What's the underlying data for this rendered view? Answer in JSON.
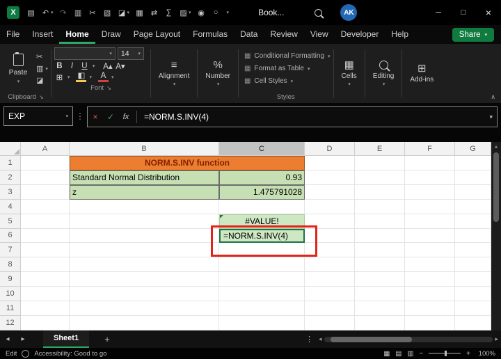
{
  "titlebar": {
    "title": "Book...",
    "avatar_initials": "AK"
  },
  "menubar": {
    "items": [
      "File",
      "Insert",
      "Home",
      "Draw",
      "Page Layout",
      "Formulas",
      "Data",
      "Review",
      "View",
      "Developer",
      "Help"
    ],
    "active": "Home",
    "share_label": "Share"
  },
  "ribbon": {
    "paste_label": "Paste",
    "font_size_value": "14",
    "styles_items": [
      "Conditional Formatting",
      "Format as Table",
      "Cell Styles"
    ],
    "group_labels": {
      "clipboard": "Clipboard",
      "font": "Font",
      "alignment": "Alignment",
      "number": "Number",
      "styles": "Styles",
      "cells": "Cells",
      "editing": "Editing",
      "addins": "Add-ins"
    }
  },
  "formula_bar": {
    "name_box_value": "EXP",
    "formula_value": "=NORM.S.INV(4)"
  },
  "grid": {
    "columns": [
      "A",
      "B",
      "C",
      "D",
      "E",
      "F",
      "G"
    ],
    "rows": [
      "1",
      "2",
      "3",
      "4",
      "5",
      "6",
      "7",
      "8",
      "9",
      "10",
      "11",
      "12"
    ],
    "selected_column": "C",
    "cells": {
      "b1_title": "NORM.S.INV function",
      "b2": "Standard Normal Distribution",
      "c2": "0.93",
      "b3": "z",
      "c3": "1.475791028",
      "c5": "#VALUE!",
      "c6": "=NORM.S.INV(4)"
    }
  },
  "sheet_bar": {
    "active_tab": "Sheet1"
  },
  "status_bar": {
    "mode": "Edit",
    "accessibility": "Accessibility: Good to go",
    "zoom": "100%"
  },
  "colors": {
    "excel_green": "#107C41",
    "tab_underline_green": "#2EA866",
    "title_cell_orange": "#ED7D31",
    "title_cell_text": "#842100",
    "input_cells_green": "#C6E0B4",
    "result_cells_green": "#CFE8C4",
    "annotation_red": "#E3231A",
    "avatar_blue": "#2268B5"
  },
  "icons": {
    "excel_logo": "X",
    "save": "▤",
    "undo": "↶",
    "redo": "↷",
    "copy": "▥",
    "cut": "✂",
    "picture": "▧",
    "paint": "◪",
    "table": "▦",
    "swap": "⇄",
    "sum": "∑",
    "chart": "▨",
    "person": "◉",
    "record": "○",
    "more": "▾",
    "chevron_down": "▾",
    "chevron_up": "▴",
    "chevron_left": "◂",
    "chevron_right": "▸",
    "minimize": "─",
    "maximize": "□",
    "close": "×",
    "cancel": "×",
    "confirm": "✓",
    "fx": "fx",
    "bold": "B",
    "italic": "I",
    "underline": "U",
    "font_increase": "A▴",
    "font_decrease": "A▾",
    "borders": "⊞",
    "fill": "◧",
    "font_color": "A",
    "align": "≡",
    "percent": "%",
    "swatch": "▦",
    "cells_icon": "▦",
    "addins_icon": "⊞",
    "launcher": "↘",
    "collapse": "∧",
    "dots": "⋮",
    "plus": "+",
    "minus": "−",
    "view_normal": "▦",
    "view_layout": "▤",
    "view_break": "▥"
  }
}
